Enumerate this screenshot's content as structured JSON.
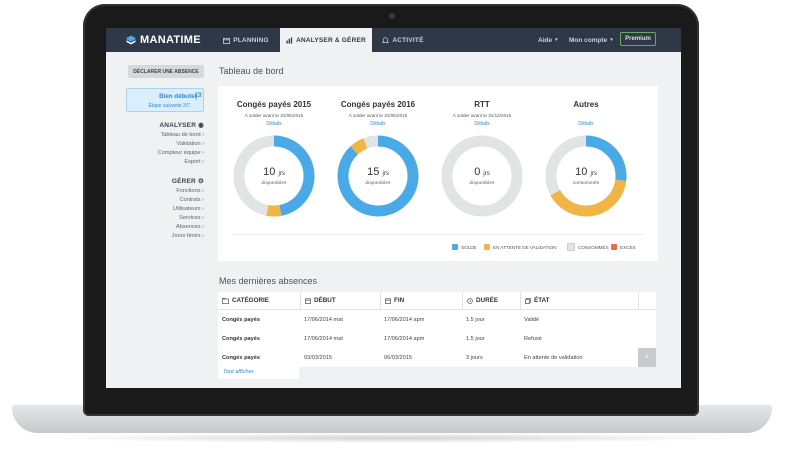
{
  "app": {
    "brand": "MANATIME"
  },
  "nav": {
    "tabs": [
      {
        "label": "PLANNING",
        "icon": "calendar-icon",
        "active": false
      },
      {
        "label": "ANALYSER & GÉRER",
        "icon": "chart-icon",
        "active": true
      },
      {
        "label": "ACTIVITÉ",
        "icon": "bell-icon",
        "active": false
      }
    ],
    "help": "Aide",
    "account": "Mon compte",
    "premium": "Premium"
  },
  "sidebar": {
    "declare_button": "DÉCLARER UNE ABSENCE",
    "welcome_title": "Bien débuter",
    "welcome_sub": "Étape suivante 3/7",
    "analyse_head": "ANALYSER",
    "analyse_items": [
      "Tableau de bord",
      "Validation",
      "Compteur équipe",
      "Export"
    ],
    "manage_head": "GÉRER",
    "manage_items": [
      "Fonctions",
      "Contrats",
      "Utilisateurs",
      "Services",
      "Absences",
      "Jours fériés"
    ]
  },
  "dashboard": {
    "title": "Tableau de bord",
    "details_label": "Détails",
    "gauges": [
      {
        "title": "Congés payés 2015",
        "sub": "À solder avant le 31/05/2015",
        "value": "10",
        "unit": "jrs",
        "caption": "disponibles",
        "segments": {
          "solde": 0.47,
          "attente": 0.06,
          "consommes": 0.47
        }
      },
      {
        "title": "Congés payés 2016",
        "sub": "À solder avant le 31/05/2016",
        "value": "15",
        "unit": "jrs",
        "caption": "disponibles",
        "segments": {
          "solde": 0.88,
          "attente": 0.06,
          "consommes": 0.06
        }
      },
      {
        "title": "RTT",
        "sub": "À solder avant le 31/12/2015",
        "value": "0",
        "unit": "jrs",
        "caption": "disponibles",
        "segments": {
          "solde": 0,
          "attente": 0,
          "consommes": 1
        }
      },
      {
        "title": "Autres",
        "sub": "",
        "value": "10",
        "unit": "jrs",
        "caption": "consommés",
        "segments": {
          "solde": 0.27,
          "attente": 0.4,
          "consommes": 0.33
        }
      }
    ],
    "legend": [
      {
        "label": "SOLDE",
        "color": "#4aaae8"
      },
      {
        "label": "EN ATTENTE DE VALIDATION",
        "color": "#f0b544"
      },
      {
        "label": "CONSOMMÉS",
        "color": "#e2e3e4"
      },
      {
        "label": "EXCÈS",
        "color": "#ec6a4a"
      }
    ]
  },
  "absences": {
    "title": "Mes dernières absences",
    "columns": [
      "CATÉGORIE",
      "DÉBUT",
      "FIN",
      "DURÉE",
      "ÉTAT"
    ],
    "rows": [
      [
        "Congés payés",
        "17/06/2014 mat",
        "17/06/2014 apm",
        "1.5 jour",
        "Validé"
      ],
      [
        "Congés payés",
        "17/06/2014 mat",
        "17/06/2014 apm",
        "1.5 jour",
        "Refusé"
      ],
      [
        "Congés payés",
        "03/03/2015",
        "06/03/2015",
        "3 jours",
        "En attente de validation"
      ]
    ],
    "close_label": "×",
    "show_all": "Tout afficher"
  },
  "colors": {
    "topbar": "#2e3847",
    "accent": "#2d8ccf",
    "solde": "#4aaae8",
    "attente": "#f0b544",
    "consommes": "#e2e3e4"
  }
}
